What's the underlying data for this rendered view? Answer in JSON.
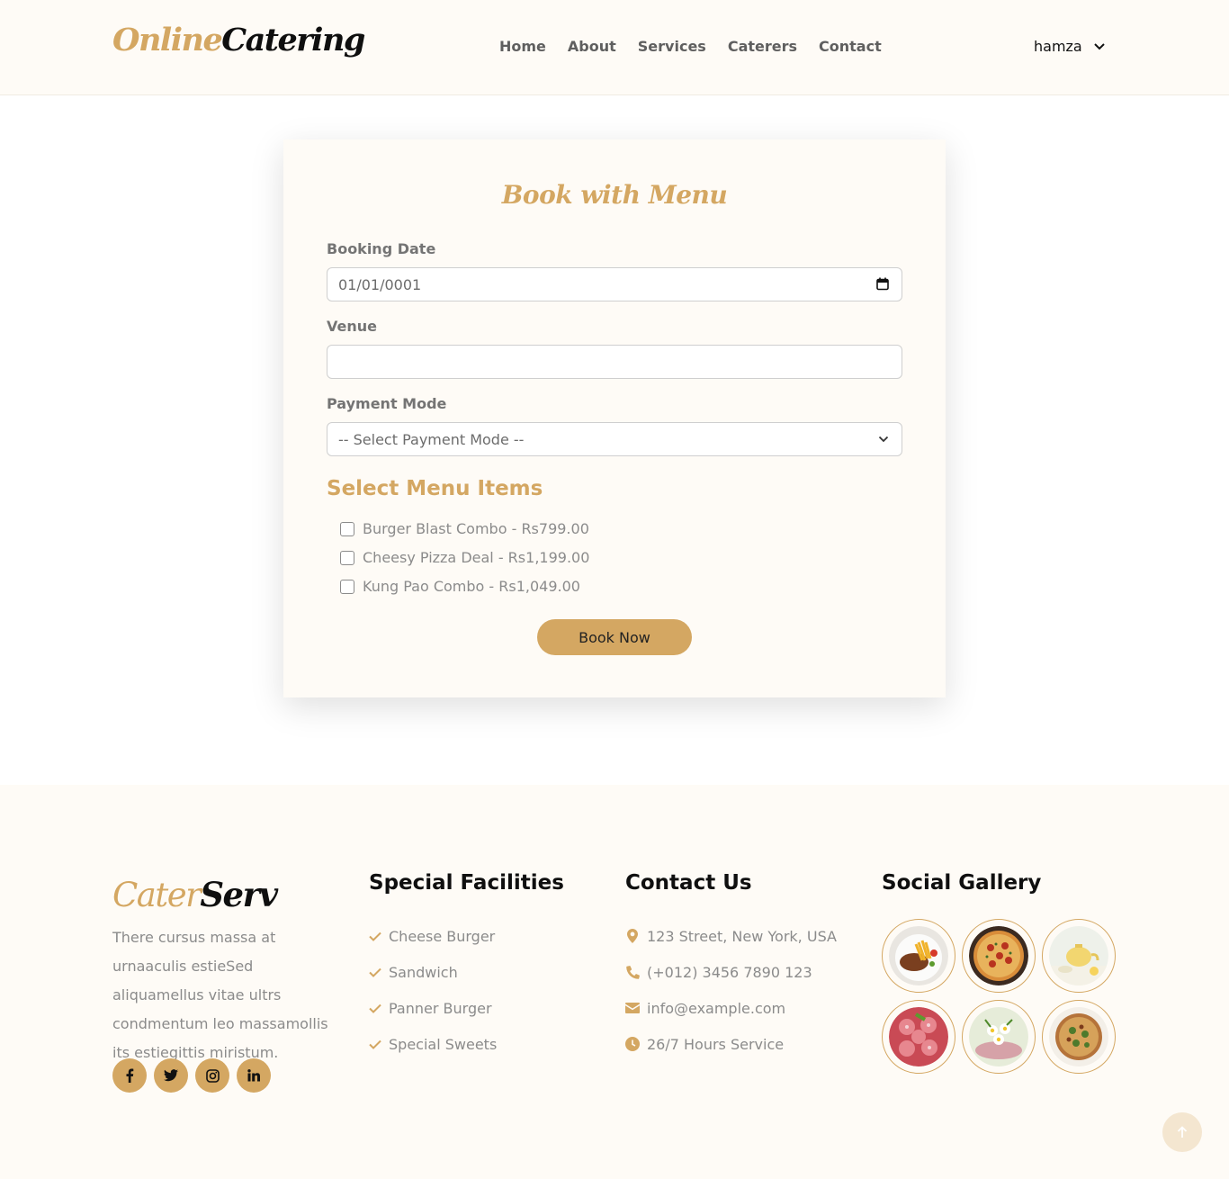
{
  "header": {
    "logo": {
      "part1": "Online",
      "part2": "Catering"
    },
    "nav": [
      "Home",
      "About",
      "Services",
      "Caterers",
      "Contact"
    ],
    "user": {
      "name": "hamza",
      "icon": "chevron-down-icon"
    }
  },
  "form": {
    "title": "Book with Menu",
    "booking_date": {
      "label": "Booking Date",
      "value": "01/01/0001",
      "icon": "calendar-icon"
    },
    "venue": {
      "label": "Venue",
      "value": ""
    },
    "payment_mode": {
      "label": "Payment Mode",
      "selected": "-- Select Payment Mode --",
      "icon": "chevron-down-icon"
    },
    "menu_title": "Select Menu Items",
    "menu_items": [
      {
        "label": "Burger Blast Combo - Rs799.00",
        "checked": false
      },
      {
        "label": "Cheesy Pizza Deal - Rs1,199.00",
        "checked": false
      },
      {
        "label": "Kung Pao Combo - Rs1,049.00",
        "checked": false
      }
    ],
    "submit_label": "Book Now"
  },
  "footer": {
    "logo": {
      "part1": "Cater",
      "part2": "Serv"
    },
    "description": "There cursus massa at urnaaculis estieSed aliquamellus vitae ultrs condmentum leo massamollis its estiegittis miristum.",
    "socials": [
      "facebook-icon",
      "twitter-icon",
      "instagram-icon",
      "linkedin-icon"
    ],
    "facilities": {
      "title": "Special Facilities",
      "items": [
        "Cheese Burger",
        "Sandwich",
        "Panner Burger",
        "Special Sweets"
      ]
    },
    "contact": {
      "title": "Contact Us",
      "items": [
        {
          "icon": "map-pin-icon",
          "text": "123 Street, New York, USA"
        },
        {
          "icon": "phone-icon",
          "text": "(+012) 3456 7890 123"
        },
        {
          "icon": "envelope-icon",
          "text": "info@example.com"
        },
        {
          "icon": "clock-icon",
          "text": "26/7 Hours Service"
        }
      ]
    },
    "gallery": {
      "title": "Social Gallery",
      "images": [
        "steak-fries-image",
        "pizza-image",
        "tea-set-image",
        "salami-platter-image",
        "flower-dish-image",
        "pizza-slice-image"
      ]
    }
  },
  "colors": {
    "accent": "#d4a762",
    "background": "#fefbf6",
    "text": "#747474"
  }
}
